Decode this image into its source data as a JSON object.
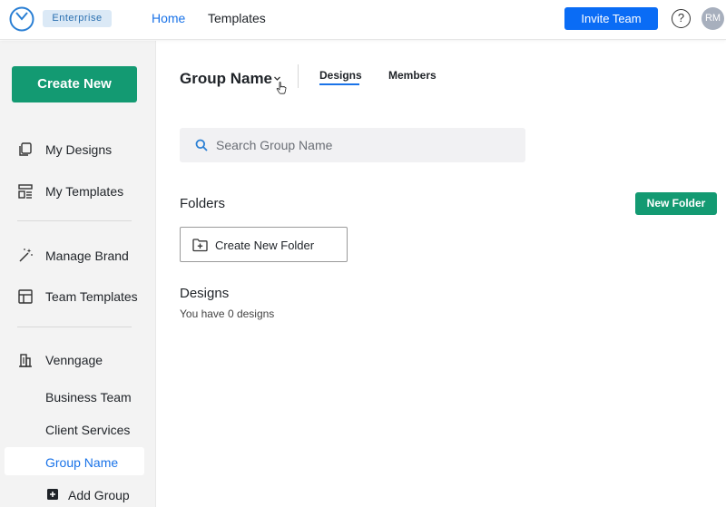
{
  "header": {
    "badge": "Enterprise",
    "nav": {
      "home": "Home",
      "templates": "Templates"
    },
    "invite_label": "Invite Team",
    "help_label": "?",
    "avatar_initials": "RM",
    "accent_color": "#1a73e8",
    "brand_color": "#139a72"
  },
  "sidebar": {
    "create_label": "Create New",
    "items": [
      {
        "label": "My Designs",
        "icon": "designs-icon"
      },
      {
        "label": "My Templates",
        "icon": "templates-icon"
      },
      {
        "label": "Manage Brand",
        "icon": "magic-wand-icon"
      },
      {
        "label": "Team Templates",
        "icon": "team-templates-icon"
      },
      {
        "label": "Venngage",
        "icon": "building-icon"
      }
    ],
    "groups": [
      "Business Team",
      "Client Services",
      "Group Name"
    ],
    "active_group": "Group Name",
    "add_group_label": "Add Group"
  },
  "main": {
    "group_title": "Group Name",
    "tabs": [
      {
        "label": "Designs",
        "active": true
      },
      {
        "label": "Members",
        "active": false
      }
    ],
    "search": {
      "placeholder": "Search Group Name",
      "value": ""
    },
    "folders": {
      "heading": "Folders",
      "new_folder_label": "New Folder",
      "create_new_folder_label": "Create New Folder"
    },
    "designs": {
      "heading": "Designs",
      "count_text": "You have 0 designs"
    }
  }
}
